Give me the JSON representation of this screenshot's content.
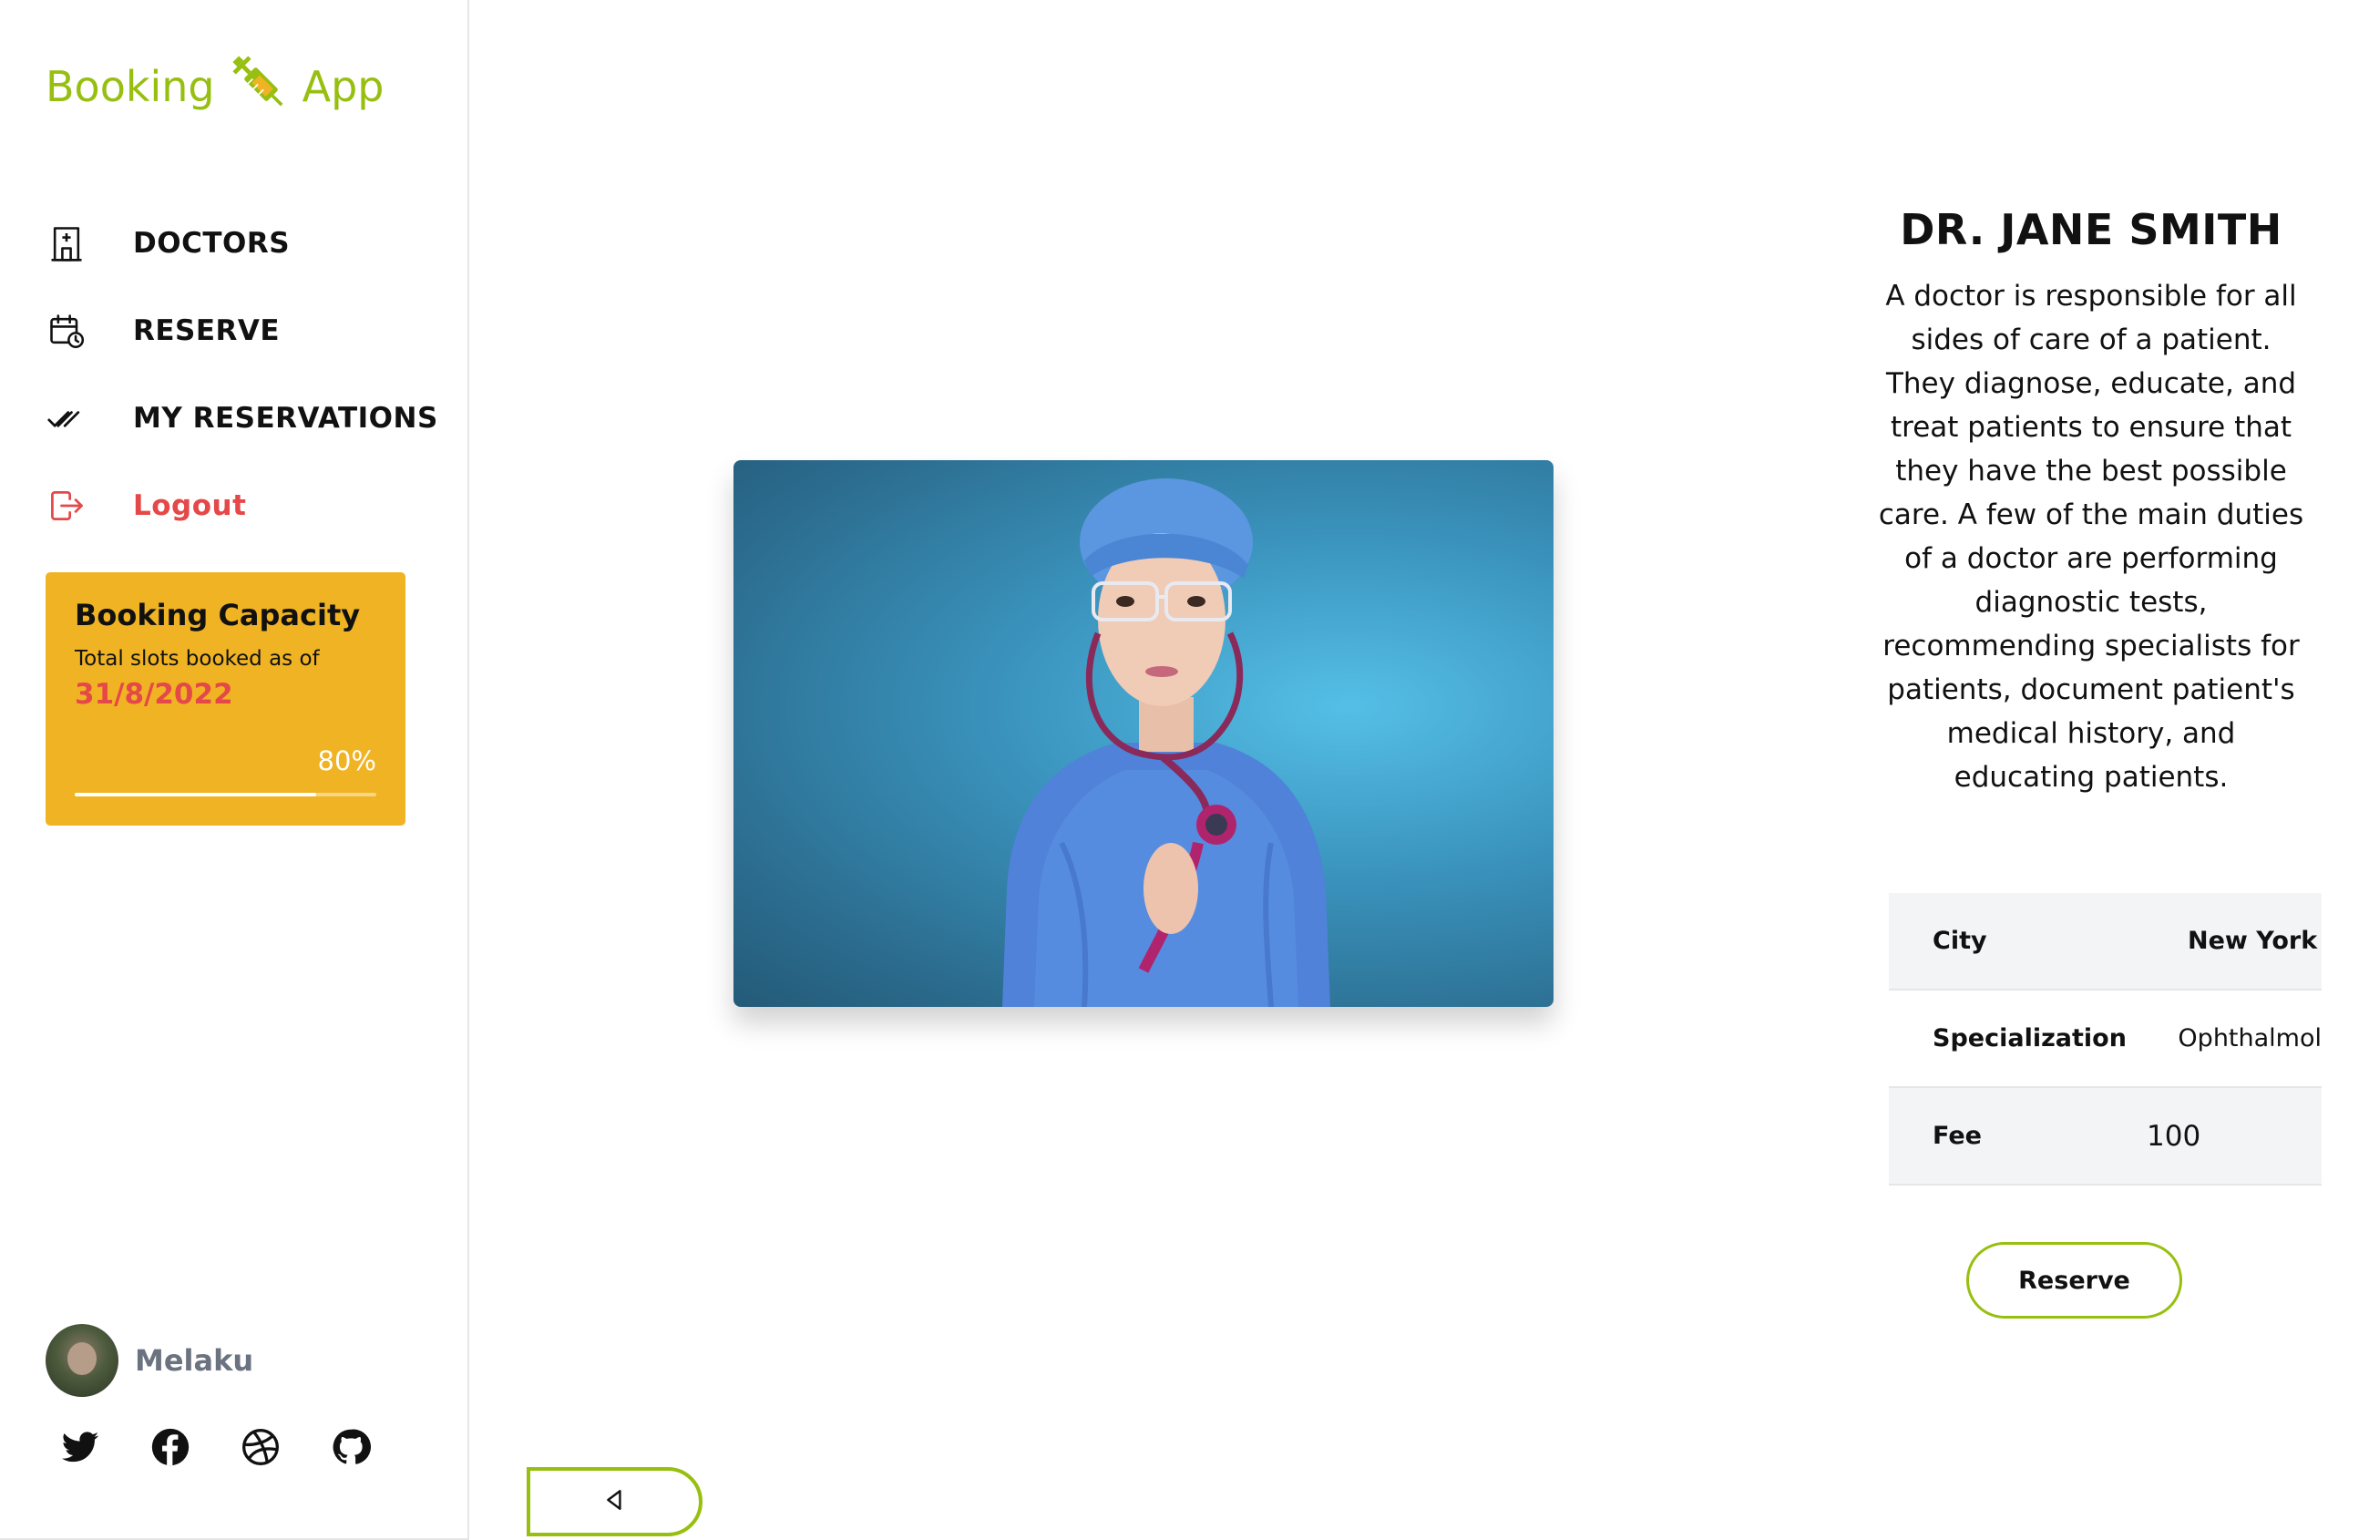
{
  "app": {
    "logo_left": "Booking",
    "logo_right": "App"
  },
  "nav": {
    "items": [
      {
        "label": "DOCTORS",
        "icon": "hospital-icon"
      },
      {
        "label": "RESERVE",
        "icon": "calendar-clock-icon"
      },
      {
        "label": "MY RESERVATIONS",
        "icon": "double-check-icon"
      },
      {
        "label": "Logout",
        "icon": "logout-icon"
      }
    ]
  },
  "capacity": {
    "title": "Booking Capacity",
    "subtitle": "Total slots booked as of",
    "date": "31/8/2022",
    "percent_label": "80%",
    "percent_value": 0.8
  },
  "user": {
    "name": "Melaku"
  },
  "socials": [
    "twitter-icon",
    "facebook-icon",
    "dribbble-icon",
    "github-icon"
  ],
  "doctor": {
    "name": "DR. JANE SMITH",
    "description": "A doctor is responsible for all sides of care of a patient. They diagnose, educate, and treat patients to ensure that they have the best possible care. A few of the main duties of a doctor are performing diagnostic tests, recommending specialists for patients, document patient's medical history, and educating patients.",
    "details": [
      {
        "key": "City",
        "value": "New York"
      },
      {
        "key": "Specialization",
        "value": "Ophthalmol"
      },
      {
        "key": "Fee",
        "value": "100"
      }
    ]
  },
  "actions": {
    "reserve_label": "Reserve"
  },
  "colors": {
    "brand": "#97bf0f",
    "capacity_card": "#f0b323",
    "danger": "#e54848"
  }
}
